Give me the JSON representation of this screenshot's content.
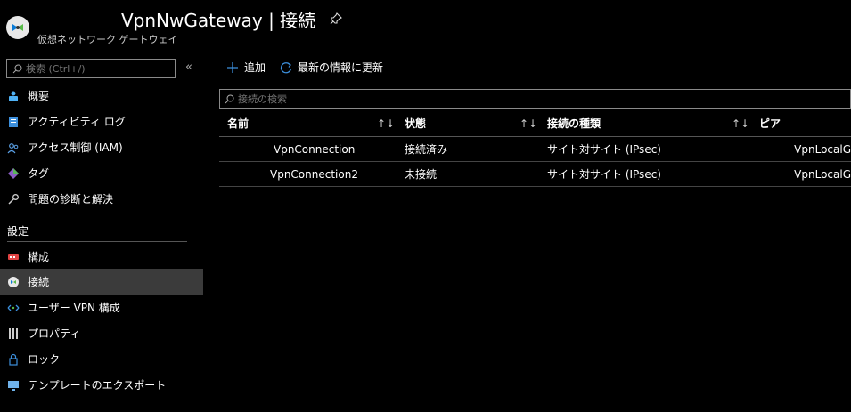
{
  "header": {
    "title_suffix": "VpnNwGateway | 接続",
    "subtitle": "仮想ネットワーク ゲートウェイ",
    "resource_icon": "vpn-gateway-icon",
    "pin_icon": "pin-icon"
  },
  "sidebar": {
    "search_placeholder": "検索 (Ctrl+/)",
    "collapse_label": "«",
    "items_top": [
      {
        "label": "概要",
        "icon": "overview-icon"
      },
      {
        "label": "アクティビティ ログ",
        "icon": "activity-log-icon"
      },
      {
        "label": "アクセス制御 (IAM)",
        "icon": "iam-icon"
      },
      {
        "label": "タグ",
        "icon": "tag-icon"
      },
      {
        "label": "問題の診断と解決",
        "icon": "wrench-icon"
      }
    ],
    "section_settings": "設定",
    "items_settings": [
      {
        "label": "構成",
        "icon": "config-icon"
      },
      {
        "label": "接続",
        "icon": "connection-icon"
      },
      {
        "label": "ユーザー VPN 構成",
        "icon": "user-vpn-icon"
      },
      {
        "label": "プロパティ",
        "icon": "properties-icon"
      },
      {
        "label": "ロック",
        "icon": "lock-icon"
      },
      {
        "label": "テンプレートのエクスポート",
        "icon": "export-template-icon"
      }
    ],
    "active_item": "接続"
  },
  "toolbar": {
    "add_label": "追加",
    "refresh_label": "最新の情報に更新"
  },
  "filter": {
    "placeholder": "接続の検索"
  },
  "table": {
    "columns": [
      {
        "label": "名前"
      },
      {
        "label": "状態"
      },
      {
        "label": "接続の種類"
      },
      {
        "label": "ピア"
      }
    ],
    "sort_glyph": "↑↓",
    "rows": [
      {
        "name": "VpnConnection",
        "status": "接続済み",
        "type": "サイト対サイト (IPsec)",
        "peer": "VpnLocalG"
      },
      {
        "name": "VpnConnection2",
        "status": "未接続",
        "type": "サイト対サイト (IPsec)",
        "peer": "VpnLocalG"
      }
    ]
  }
}
